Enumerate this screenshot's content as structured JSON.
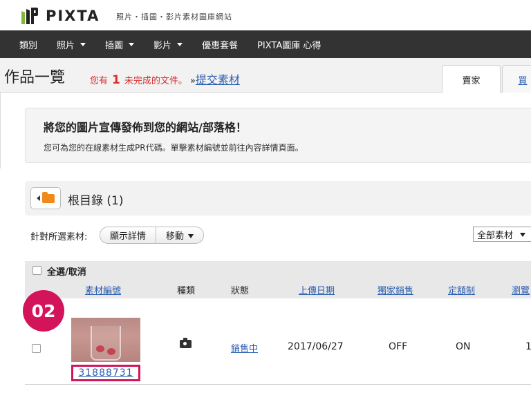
{
  "header": {
    "logo_text": "PIXTA",
    "tagline": "照片・插圖・影片素材圖庫網站"
  },
  "nav": {
    "items": [
      {
        "label": "類別",
        "has_dropdown": false
      },
      {
        "label": "照片",
        "has_dropdown": true
      },
      {
        "label": "插圖",
        "has_dropdown": true
      },
      {
        "label": "影片",
        "has_dropdown": true
      },
      {
        "label": "優惠套餐",
        "has_dropdown": false
      },
      {
        "label": "PIXTA圖庫 心得",
        "has_dropdown": false
      }
    ]
  },
  "title_bar": {
    "page_title": "作品一覽",
    "notice_prefix": "您有",
    "notice_count": "1",
    "notice_suffix": "未完成的文件。",
    "notice_arrow": "»",
    "submit_link": "提交素材",
    "tabs": [
      {
        "label": "賣家",
        "active": true
      },
      {
        "label": "買",
        "active": false
      }
    ]
  },
  "promo": {
    "title": "將您的圖片宣傳發佈到您的網站/部落格！",
    "subtitle": "您可為您的在線素材生成PR代碼。單擊素材編號並前往內容詳情頁面。"
  },
  "directory": {
    "label": "根目錄 (1)"
  },
  "actions": {
    "label": "針對所選素材:",
    "show_details": "顯示詳情",
    "move": "移動",
    "filter_selected": "全部素材"
  },
  "table": {
    "select_all": "全選/取消",
    "columns": {
      "id": "素材編號",
      "type": "種類",
      "status": "狀態",
      "upload_date": "上傳日期",
      "exclusive": "獨家銷售",
      "fixed_price": "定額制",
      "views": "瀏覽"
    },
    "rows": [
      {
        "id": "31888731",
        "type_icon": "camera-icon",
        "status": "銷售中",
        "upload_date": "2017/06/27",
        "exclusive": "OFF",
        "fixed_price": "ON",
        "views": "1"
      }
    ]
  },
  "annotation": {
    "step_label": "02"
  },
  "colors": {
    "nav_bg": "#333333",
    "accent_red": "#d62e2e",
    "highlight_pink": "#d4145a",
    "link_blue": "#2a5db0",
    "folder_orange": "#f28a1b"
  }
}
